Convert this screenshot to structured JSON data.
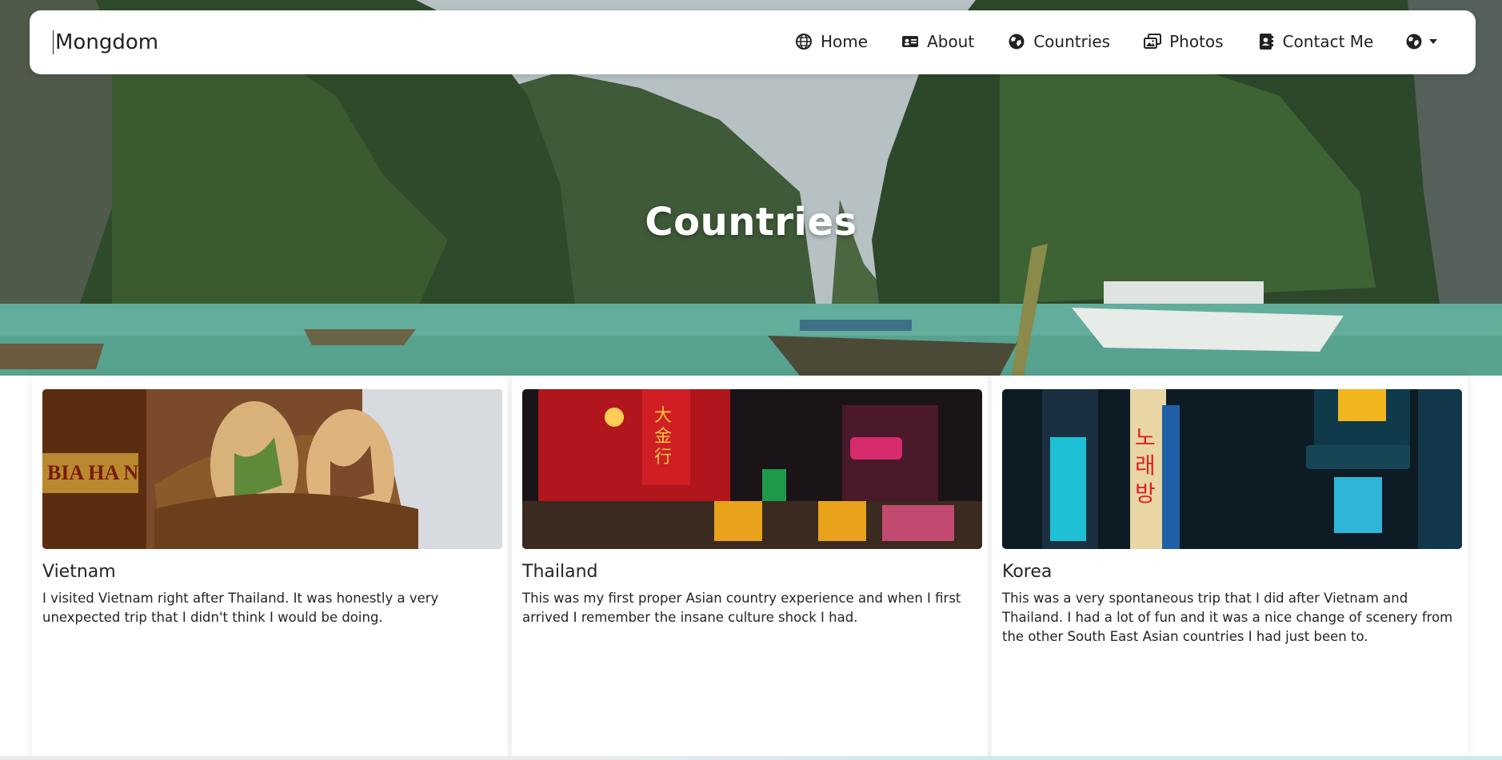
{
  "brand": "Mongdom",
  "nav": {
    "items": [
      {
        "label": "Home",
        "icon": "globe-icon"
      },
      {
        "label": "About",
        "icon": "id-card-icon"
      },
      {
        "label": "Countries",
        "icon": "earth-icon"
      },
      {
        "label": "Photos",
        "icon": "photos-icon"
      },
      {
        "label": "Contact Me",
        "icon": "contact-book-icon"
      }
    ],
    "language_icon": "earth-icon"
  },
  "hero": {
    "title": "Countries"
  },
  "cards": [
    {
      "title": "Vietnam",
      "text": "I visited Vietnam right after Thailand. It was honestly a very unexpected trip that I didn't think I would be doing."
    },
    {
      "title": "Thailand",
      "text": "This was my first proper Asian country experience and when I first arrived I remember the insane culture shock I had."
    },
    {
      "title": "Korea",
      "text": "This was a very spontaneous trip that I did after Vietnam and Thailand. I had a lot of fun and it was a nice change of scenery from the other South East Asian countries I had just been to."
    }
  ],
  "colors": {
    "navbar_bg": "#ffffff",
    "text": "#212529",
    "hero_title": "#ffffff",
    "water": "#5faa98"
  }
}
